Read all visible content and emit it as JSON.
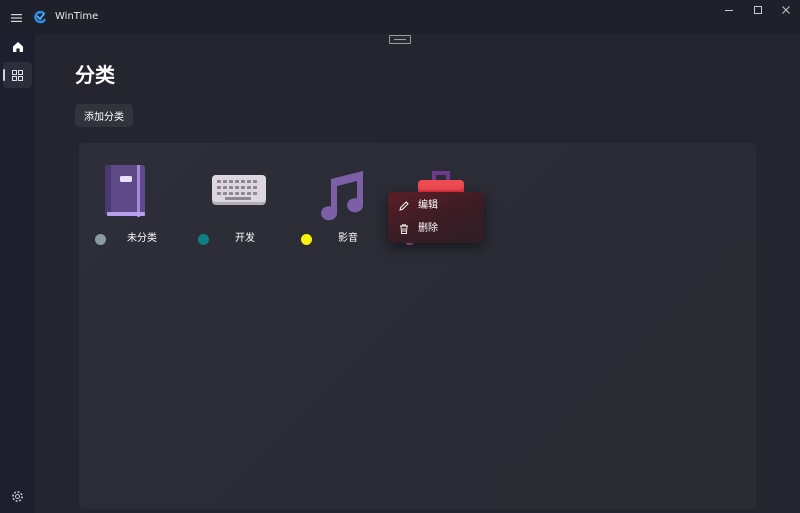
{
  "window": {
    "app_title": "WinTime",
    "icons": [
      "menu-icon",
      "app-logo-icon",
      "minimize-icon",
      "maximize-icon",
      "close-icon"
    ]
  },
  "nav": {
    "items": [
      {
        "icon": "home-icon",
        "active": false
      },
      {
        "icon": "category-icon",
        "active": true
      }
    ],
    "settings_icon": "gear-icon"
  },
  "page": {
    "title": "分类",
    "add_button_label": "添加分类"
  },
  "categories": [
    {
      "label": "未分类",
      "dot_color": "#8e9aa3",
      "icon": "notebook-icon"
    },
    {
      "label": "开发",
      "dot_color": "#0e7f85",
      "icon": "keyboard-icon"
    },
    {
      "label": "影音",
      "dot_color": "#f9f20b",
      "icon": "music-note-icon"
    },
    {
      "label": "",
      "dot_color": "#c061a8",
      "icon": "toolbox-icon"
    }
  ],
  "context_menu": {
    "items": [
      {
        "label": "编辑",
        "icon": "pencil-icon"
      },
      {
        "label": "删除",
        "icon": "trash-icon"
      }
    ]
  },
  "colors": {
    "background": "#202027",
    "nav_rail": "#1d1f2e",
    "panel": "#2d2e39",
    "accent": "#2b8ff0"
  }
}
